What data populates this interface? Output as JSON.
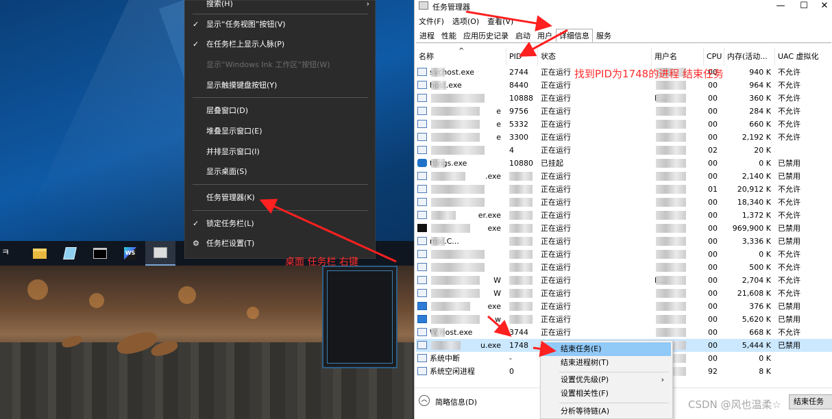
{
  "taskbar_menu": {
    "items": [
      {
        "label": "搜索(H)",
        "checked": false,
        "disabled": false,
        "submenu": true
      },
      {
        "label": "显示“任务视图”按钮(V)",
        "checked": true,
        "disabled": false
      },
      {
        "label": "在任务栏上显示人脉(P)",
        "checked": true,
        "disabled": false
      },
      {
        "label": "显示“Windows Ink 工作区”按钮(W)",
        "checked": false,
        "disabled": true
      },
      {
        "label": "显示触摸键盘按钮(Y)",
        "checked": false,
        "disabled": false
      },
      {
        "label": "层叠窗口(D)",
        "checked": false,
        "disabled": false
      },
      {
        "label": "堆叠显示窗口(E)",
        "checked": false,
        "disabled": false
      },
      {
        "label": "并排显示窗口(I)",
        "checked": false,
        "disabled": false
      },
      {
        "label": "显示桌面(S)",
        "checked": false,
        "disabled": false
      },
      {
        "label": "任务管理器(K)",
        "checked": false,
        "disabled": false
      },
      {
        "label": "锁定任务栏(L)",
        "checked": true,
        "disabled": false
      },
      {
        "label": "任务栏设置(T)",
        "checked": false,
        "disabled": false,
        "icon": "gear-icon"
      }
    ],
    "check_glyph": "✓",
    "submenu_glyph": "›",
    "gear_glyph": "⚙"
  },
  "taskbar": {
    "left_glyph": "ㅋ",
    "apps": [
      {
        "name": "file-explorer-icon"
      },
      {
        "name": "notepad-icon"
      },
      {
        "name": "cmd-icon"
      },
      {
        "name": "webstorm-icon",
        "text": "WS"
      },
      {
        "name": "task-manager-icon",
        "active": true
      }
    ]
  },
  "annotations": {
    "desktop": "桌面 任务栏 右键",
    "task_manager": "找到PID为1748的进程 结束任务"
  },
  "task_manager": {
    "title": "任务管理器",
    "window_buttons": {
      "minimize": "—",
      "maximize": "☐",
      "close": "✕"
    },
    "menu": [
      "文件(F)",
      "选项(O)",
      "查看(V)"
    ],
    "tabs": [
      "进程",
      "性能",
      "应用历史记录",
      "启动",
      "用户",
      "详细信息",
      "服务"
    ],
    "active_tab": "详细信息",
    "columns": [
      "名称",
      "PID",
      "状态",
      "用户名",
      "CPU",
      "内存(活动...",
      "UAC 虚拟化"
    ],
    "sort_glyph": "^",
    "rows": [
      {
        "icon": "default",
        "name": "svchost.exe",
        "pid": "2744",
        "status": "正在运行",
        "user": "",
        "cpu": "00",
        "mem": "940 K",
        "uac": "不允许"
      },
      {
        "icon": "default",
        "name": "host.exe",
        "pid": "8440",
        "status": "正在运行",
        "user": "",
        "cpu": "00",
        "mem": "964 K",
        "uac": "不允许"
      },
      {
        "icon": "default",
        "name": "",
        "pid": "10888",
        "status": "正在运行",
        "user": "E...",
        "cpu": "00",
        "mem": "360 K",
        "uac": "不允许"
      },
      {
        "icon": "default",
        "name": "e",
        "pid": "9756",
        "status": "正在运行",
        "user": "",
        "cpu": "00",
        "mem": "284 K",
        "uac": "不允许"
      },
      {
        "icon": "default",
        "name": "e",
        "pid": "5332",
        "status": "正在运行",
        "user": "",
        "cpu": "00",
        "mem": "660 K",
        "uac": "不允许"
      },
      {
        "icon": "default",
        "name": "e",
        "pid": "3300",
        "status": "正在运行",
        "user": "",
        "cpu": "00",
        "mem": "2,192 K",
        "uac": "不允许"
      },
      {
        "icon": "default",
        "name": "",
        "pid": "4",
        "status": "正在运行",
        "user": "",
        "cpu": "02",
        "mem": "20 K",
        "uac": ""
      },
      {
        "icon": "gear",
        "name": "ttings.exe",
        "pid": "10880",
        "status": "已挂起",
        "user": "",
        "cpu": "00",
        "mem": "0 K",
        "uac": "已禁用"
      },
      {
        "icon": "default",
        "name": ".exe",
        "pid": "",
        "status": "正在运行",
        "user": "",
        "cpu": "00",
        "mem": "2,140 K",
        "uac": "已禁用"
      },
      {
        "icon": "default",
        "name": "",
        "pid": "",
        "status": "正在运行",
        "user": "",
        "cpu": "01",
        "mem": "20,912 K",
        "uac": "不允许"
      },
      {
        "icon": "default",
        "name": "",
        "pid": "",
        "status": "正在运行",
        "user": "",
        "cpu": "00",
        "mem": "18,340 K",
        "uac": "不允许"
      },
      {
        "icon": "default",
        "name": "er.exe",
        "pid": "",
        "status": "正在运行",
        "user": "",
        "cpu": "00",
        "mem": "1,372 K",
        "uac": "不允许"
      },
      {
        "icon": "ws",
        "name": "exe",
        "pid": "",
        "status": "正在运行",
        "user": "",
        "cpu": "00",
        "mem": "969,900 K",
        "uac": "已禁用"
      },
      {
        "icon": "default",
        "name": "rnal.C...",
        "pid": "",
        "status": "正在运行",
        "user": "",
        "cpu": "00",
        "mem": "3,336 K",
        "uac": "已禁用"
      },
      {
        "icon": "default",
        "name": "",
        "pid": "",
        "status": "正在运行",
        "user": "",
        "cpu": "00",
        "mem": "0 K",
        "uac": "不允许"
      },
      {
        "icon": "default",
        "name": "",
        "pid": "",
        "status": "正在运行",
        "user": "",
        "cpu": "00",
        "mem": "500 K",
        "uac": "不允许"
      },
      {
        "icon": "default",
        "name": "W",
        "pid": "",
        "status": "正在运行",
        "user": "E...",
        "cpu": "00",
        "mem": "2,704 K",
        "uac": "不允许"
      },
      {
        "icon": "default",
        "name": "W",
        "pid": "",
        "status": "正在运行",
        "user": "",
        "cpu": "00",
        "mem": "21,608 K",
        "uac": "不允许"
      },
      {
        "icon": "blue",
        "name": "exe",
        "pid": "",
        "status": "正在运行",
        "user": "",
        "cpu": "00",
        "mem": "376 K",
        "uac": "已禁用"
      },
      {
        "icon": "blue",
        "name": "w",
        "pid": "",
        "status": "正在运行",
        "user": "",
        "cpu": "00",
        "mem": "5,620 K",
        "uac": "已禁用"
      },
      {
        "icon": "default",
        "name": "W Host.exe",
        "pid": "3744",
        "status": "正在运行",
        "user": "",
        "cpu": "00",
        "mem": "668 K",
        "uac": "不允许"
      },
      {
        "icon": "default",
        "name": "u.exe",
        "pid": "1748",
        "status": "",
        "user": "",
        "cpu": "00",
        "mem": "5,444 K",
        "uac": "已禁用",
        "selected": true
      },
      {
        "icon": "default",
        "name": "系统中断",
        "pid": "-",
        "status": "",
        "user": "",
        "cpu": "00",
        "mem": "0 K",
        "uac": ""
      },
      {
        "icon": "default",
        "name": "系统空闲进程",
        "pid": "0",
        "status": "",
        "user": "",
        "cpu": "92",
        "mem": "8 K",
        "uac": ""
      }
    ],
    "row_menu": [
      {
        "label": "结束任务(E)",
        "highlighted": true
      },
      {
        "label": "结束进程树(T)"
      },
      {
        "label": "设置优先级(P)",
        "submenu": true
      },
      {
        "label": "设置相关性(F)"
      },
      {
        "label": "分析等待链(A)"
      }
    ],
    "fewer_details": "简略信息(D)",
    "fewer_glyph": "︿",
    "end_task_button": "结束任务"
  },
  "watermark": "CSDN @风也温柔☆"
}
